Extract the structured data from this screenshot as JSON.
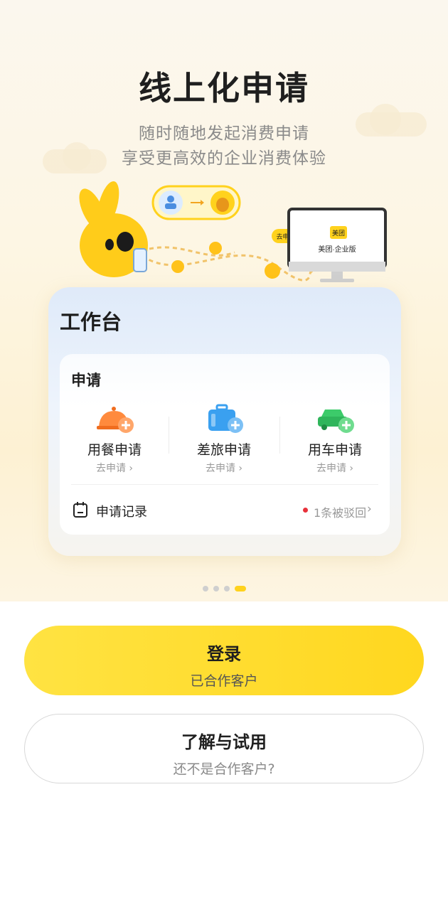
{
  "hero": {
    "title": "线上化申请",
    "subtitle_line1": "随时随地发起消费申请",
    "subtitle_line2": "享受更高效的企业消费体验",
    "illustration": {
      "monitor_logo": "美团",
      "monitor_text": "美团·企业版",
      "bubble_label": "去申请"
    }
  },
  "workspace": {
    "title": "工作台",
    "section_title": "申请",
    "items": [
      {
        "icon": "dining-bell-icon",
        "label": "用餐申请",
        "action": "去申请 ›",
        "color": "#ff8a3d"
      },
      {
        "icon": "suitcase-icon",
        "label": "差旅申请",
        "action": "去申请 ›",
        "color": "#3aa0f0"
      },
      {
        "icon": "car-icon",
        "label": "用车申请",
        "action": "去申请 ›",
        "color": "#3ccb6a"
      }
    ],
    "record": {
      "label": "申请记录",
      "status": "1条被驳回",
      "chevron": "›",
      "status_color": "#e8313b"
    }
  },
  "pagination": {
    "count": 4,
    "active_index": 3
  },
  "buttons": {
    "login": {
      "label": "登录",
      "sublabel": "已合作客户"
    },
    "trial": {
      "label": "了解与试用",
      "sublabel": "还不是合作客户?"
    }
  },
  "colors": {
    "brand_yellow": "#ffd71f",
    "accent_red": "#e8313b"
  }
}
